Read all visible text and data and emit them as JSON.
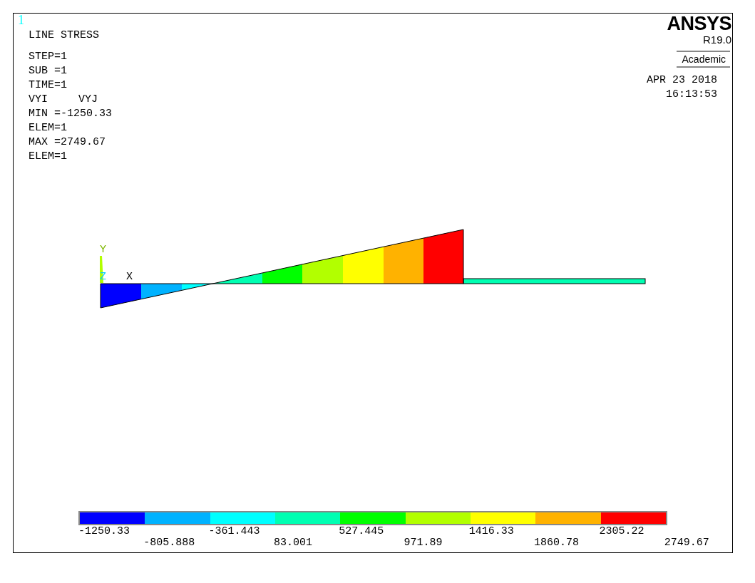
{
  "window_number": "1",
  "title": "LINE STRESS",
  "info_lines": [
    "STEP=1",
    "SUB =1",
    "TIME=1"
  ],
  "components": [
    "VYI",
    "VYJ"
  ],
  "extremes": [
    "MIN =-1250.33",
    "ELEM=1",
    "MAX =2749.67",
    "ELEM=1"
  ],
  "logo": {
    "brand": "ANSYS",
    "version": "R19.0",
    "edition": "Academic"
  },
  "date": "APR 23 2018",
  "time": "16:13:53",
  "axes": {
    "y": "Y",
    "z": "Z",
    "x": "X"
  },
  "legend": {
    "bands": [
      {
        "color": "#0000ff"
      },
      {
        "color": "#00b2ff"
      },
      {
        "color": "#00ffff"
      },
      {
        "color": "#00ffb2"
      },
      {
        "color": "#00ff00"
      },
      {
        "color": "#b2ff00"
      },
      {
        "color": "#ffff00"
      },
      {
        "color": "#ffb200"
      },
      {
        "color": "#ff0000"
      }
    ],
    "labels": [
      "-1250.33",
      "-805.888",
      "-361.443",
      "83.001",
      "527.445",
      "971.89",
      "1416.33",
      "1860.78",
      "2305.22",
      "2749.67"
    ]
  }
}
